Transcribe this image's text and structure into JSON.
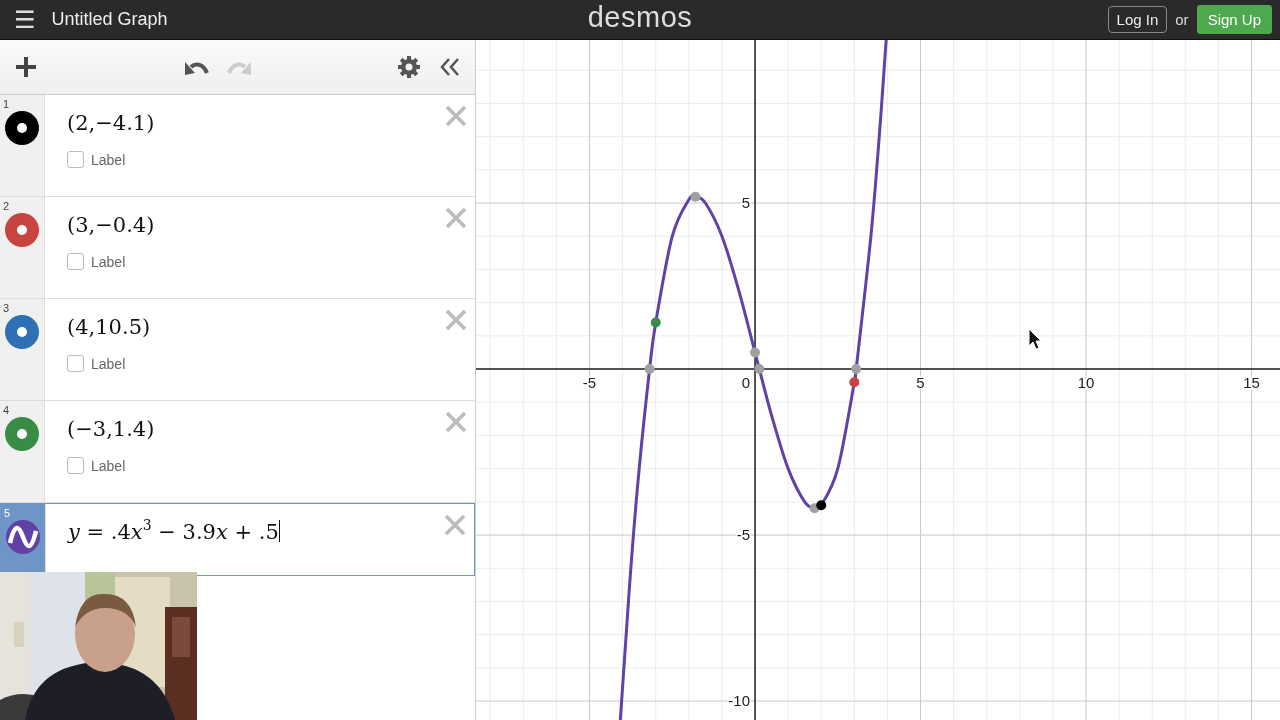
{
  "header": {
    "menu": "☰",
    "title": "Untitled Graph",
    "logo": "desmos",
    "login": "Log In",
    "or": "or",
    "signup": "Sign Up"
  },
  "toolbar": {
    "redo_disabled": true
  },
  "expressions": [
    {
      "index": "1",
      "kind": "point",
      "color": "#000000",
      "text": "(2,−4.1)",
      "label": "Label",
      "checked": false,
      "selected": false
    },
    {
      "index": "2",
      "kind": "point",
      "color": "#c74440",
      "text": "(3,−0.4)",
      "label": "Label",
      "checked": false,
      "selected": false
    },
    {
      "index": "3",
      "kind": "point",
      "color": "#2d70b3",
      "text": "(4,10.5)",
      "label": "Label",
      "checked": false,
      "selected": false
    },
    {
      "index": "4",
      "kind": "point",
      "color": "#388c46",
      "text": "(−3,1.4)",
      "label": "Label",
      "checked": false,
      "selected": false
    },
    {
      "index": "5",
      "kind": "function",
      "color": "#6042a6",
      "parts": [
        {
          "text": "y",
          "kind": "variable"
        },
        {
          "text": " = .4",
          "kind": "number"
        },
        {
          "text": "x",
          "kind": "variable"
        },
        {
          "text": "3",
          "kind": "exponent"
        },
        {
          "text": " − 3.9",
          "kind": "number"
        },
        {
          "text": "x",
          "kind": "variable"
        },
        {
          "text": " + .5",
          "kind": "number"
        }
      ],
      "selected": true
    }
  ],
  "graph": {
    "origin_label": "0",
    "chart_data": {
      "type": "line",
      "x": [
        -4.05,
        -3.75,
        -3.5,
        -3.185,
        -3,
        -2.5,
        -2,
        -1.8,
        -1.5,
        -1,
        -0.5,
        0,
        0.13,
        0.5,
        1,
        1.5,
        1.8,
        2,
        2.5,
        3,
        3.056,
        3.5,
        3.75,
        3.95
      ],
      "series": [
        {
          "color": "#6042a6",
          "values": [
            -10.28,
            -5.97,
            -3.0,
            0.0,
            1.4,
            4.0,
            5.1,
            5.19,
            5.0,
            4.0,
            2.4,
            0.5,
            0.0,
            -1.4,
            -3.0,
            -4.0,
            -4.19,
            -4.1,
            -3.0,
            -0.4,
            0.0,
            4.0,
            6.97,
            9.75
          ]
        },
        {
          "color": "#a0a0a0",
          "marker": "circle",
          "values": [
            null,
            null,
            null,
            0,
            null,
            null,
            null,
            null,
            null,
            null,
            null,
            null,
            null,
            null,
            null,
            null,
            null,
            null,
            null,
            null,
            null,
            null,
            null,
            null
          ]
        },
        {
          "color": "#a0a0a0",
          "marker": "circle",
          "values": [
            null,
            null,
            null,
            null,
            null,
            null,
            null,
            5.19,
            null,
            null,
            null,
            null,
            null,
            null,
            null,
            null,
            null,
            null,
            null,
            null,
            null,
            null,
            null,
            null
          ]
        },
        {
          "color": "#a0a0a0",
          "marker": "circle",
          "values": [
            null,
            null,
            null,
            null,
            null,
            null,
            null,
            null,
            null,
            null,
            null,
            0.5,
            null,
            null,
            null,
            null,
            null,
            null,
            null,
            null,
            null,
            null,
            null,
            null
          ]
        },
        {
          "color": "#a0a0a0",
          "marker": "circle",
          "values": [
            null,
            null,
            null,
            null,
            null,
            null,
            null,
            null,
            null,
            null,
            null,
            null,
            0,
            null,
            null,
            null,
            null,
            null,
            null,
            null,
            null,
            null,
            null,
            null
          ]
        },
        {
          "color": "#a0a0a0",
          "marker": "circle",
          "values": [
            null,
            null,
            null,
            null,
            null,
            null,
            null,
            null,
            null,
            null,
            null,
            null,
            null,
            null,
            null,
            null,
            -4.19,
            null,
            null,
            null,
            null,
            null,
            null,
            null
          ]
        },
        {
          "color": "#a0a0a0",
          "marker": "circle",
          "values": [
            null,
            null,
            null,
            null,
            null,
            null,
            null,
            null,
            null,
            null,
            null,
            null,
            null,
            null,
            null,
            null,
            null,
            null,
            null,
            null,
            0,
            null,
            null,
            null
          ]
        },
        {
          "color": "#000000",
          "marker": "circle",
          "values": [
            null,
            null,
            null,
            null,
            null,
            null,
            null,
            null,
            null,
            null,
            null,
            null,
            null,
            null,
            null,
            null,
            null,
            -4.1,
            null,
            null,
            null,
            null,
            null,
            null
          ]
        },
        {
          "color": "#c74440",
          "marker": "circle",
          "values": [
            null,
            null,
            null,
            null,
            null,
            null,
            null,
            null,
            null,
            null,
            null,
            null,
            null,
            null,
            null,
            null,
            null,
            null,
            null,
            -0.4,
            null,
            null,
            null,
            null
          ]
        },
        {
          "color": "#388c46",
          "marker": "circle",
          "values": [
            null,
            null,
            null,
            null,
            1.4,
            null,
            null,
            null,
            null,
            null,
            null,
            null,
            null,
            null,
            null,
            null,
            null,
            null,
            null,
            null,
            null,
            null,
            null,
            null
          ]
        }
      ],
      "grid": true,
      "xlim": [
        -8.43,
        15.86
      ],
      "ylim": [
        -10.57,
        9.91
      ],
      "xticks": [
        -5,
        {
          "value": 5,
          "label": "5"
        },
        10,
        15
      ],
      "yticks": [
        -10,
        -5,
        {
          "value": 5,
          "label": "5"
        }
      ]
    }
  }
}
